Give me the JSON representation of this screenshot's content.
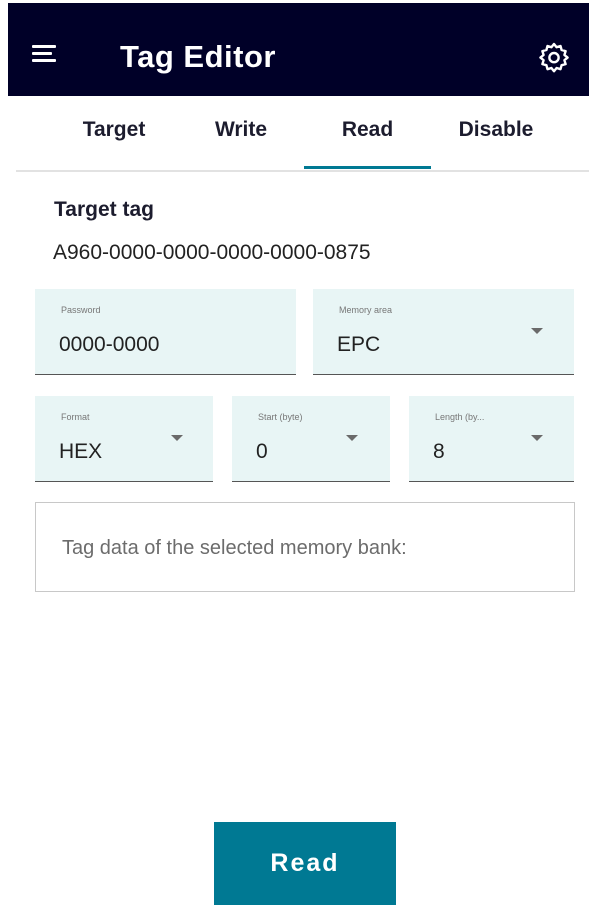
{
  "header": {
    "title": "Tag Editor",
    "menu_icon": "menu-icon",
    "settings_icon": "gear-icon",
    "background": "#000028"
  },
  "tabs": [
    {
      "label": "Target"
    },
    {
      "label": "Write"
    },
    {
      "label": "Read",
      "active": true
    },
    {
      "label": "Disable"
    }
  ],
  "target": {
    "heading": "Target tag",
    "tag_id": "A960-0000-0000-0000-0000-0875"
  },
  "fields": {
    "password": {
      "label": "Password",
      "value": "0000-0000"
    },
    "memory_area": {
      "label": "Memory area",
      "value": "EPC"
    },
    "format": {
      "label": "Format",
      "value": "HEX"
    },
    "start": {
      "label": "Start (byte)",
      "value": "0"
    },
    "length": {
      "label": "Length (by...",
      "value": "8"
    }
  },
  "tag_data": {
    "placeholder": "Tag data of the selected memory bank:"
  },
  "actions": {
    "read_label": "Read",
    "accent": "#007993"
  }
}
